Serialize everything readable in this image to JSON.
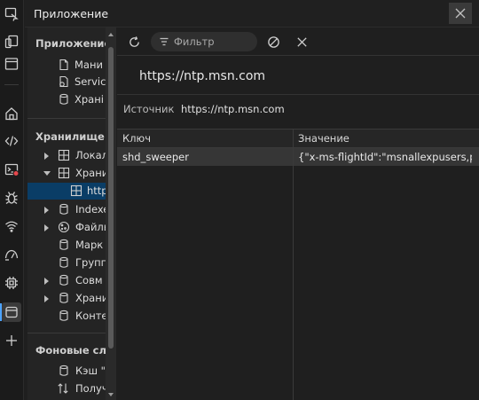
{
  "window": {
    "title": "Приложение"
  },
  "activity_bar": [
    {
      "name": "inspect-icon"
    },
    {
      "name": "device-emulation-icon"
    },
    {
      "name": "panel-toggle-icon"
    },
    {
      "name": "welcome-home-icon"
    },
    {
      "name": "elements-icon"
    },
    {
      "name": "console-icon",
      "badge": "error"
    },
    {
      "name": "sources-bug-icon"
    },
    {
      "name": "network-wifi-icon"
    },
    {
      "name": "performance-icon"
    },
    {
      "name": "memory-chip-icon"
    },
    {
      "name": "application-icon",
      "active": true
    },
    {
      "name": "add-tool-icon"
    }
  ],
  "sidebar": {
    "sections": [
      {
        "title": "Приложение",
        "items": [
          {
            "label": "Мани",
            "icon": "file-icon"
          },
          {
            "label": "Servic",
            "icon": "gear-icon"
          },
          {
            "label": "Храні",
            "icon": "database-icon"
          }
        ]
      },
      {
        "title": "Хранилище",
        "items": [
          {
            "label": "Локал",
            "icon": "table-grid-icon",
            "expander": "collapsed"
          },
          {
            "label": "Храни",
            "icon": "table-grid-icon",
            "expander": "expanded"
          },
          {
            "label": "http",
            "icon": "table-grid-icon",
            "selected": true
          },
          {
            "label": "Indexe",
            "icon": "database-icon",
            "expander": "collapsed"
          },
          {
            "label": "Файлы",
            "icon": "cookie-icon",
            "expander": "collapsed"
          },
          {
            "label": "Марк",
            "icon": "database-icon"
          },
          {
            "label": "Групп",
            "icon": "database-icon"
          },
          {
            "label": "Совм",
            "icon": "database-icon",
            "expander": "collapsed"
          },
          {
            "label": "Храни",
            "icon": "database-icon",
            "expander": "collapsed"
          },
          {
            "label": "Конте",
            "icon": "database-icon"
          }
        ]
      },
      {
        "title": "Фоновые слу:",
        "items": [
          {
            "label": "Кэш \"",
            "icon": "database-icon"
          },
          {
            "label": "Получ",
            "icon": "sync-arrows-icon"
          }
        ]
      }
    ]
  },
  "toolbar": {
    "refresh_icon": "refresh-icon",
    "filter_placeholder": "Фильтр",
    "clear_icon": "clear-block-icon",
    "delete_icon": "close-x-icon"
  },
  "origin": {
    "title": "https://ntp.msn.com",
    "source_label": "Источник",
    "source_value": "https://ntp.msn.com"
  },
  "table": {
    "columns": [
      "Ключ",
      "Значение"
    ],
    "rows": [
      {
        "key": "shd_sweeper",
        "value": "{\"x-ms-flightId\":\"msnallexpusers,p..."
      }
    ]
  },
  "colors": {
    "selection": "#0a3d66",
    "accent": "#4da3ff",
    "row_highlight": "#363636",
    "error_badge": "#e5484d"
  }
}
